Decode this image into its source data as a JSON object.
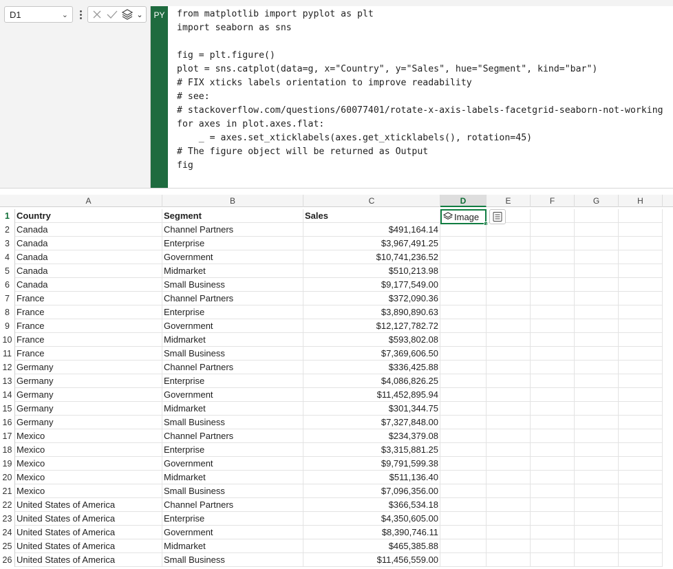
{
  "namebox": {
    "value": "D1"
  },
  "code_panel": {
    "badge": "PY",
    "lines": [
      "from matplotlib import pyplot as plt",
      "import seaborn as sns",
      "",
      "fig = plt.figure()",
      "plot = sns.catplot(data=g, x=\"Country\", y=\"Sales\", hue=\"Segment\", kind=\"bar\")",
      "# FIX xticks labels orientation to improve readability",
      "# see:",
      "# stackoverflow.com/questions/60077401/rotate-x-axis-labels-facetgrid-seaborn-not-working",
      "for axes in plot.axes.flat:",
      "    _ = axes.set_xticklabels(axes.get_xticklabels(), rotation=45)",
      "# The figure object will be returned as Output",
      "fig"
    ]
  },
  "columns": [
    "A",
    "B",
    "C",
    "D",
    "E",
    "F",
    "G",
    "H"
  ],
  "selected_column": "D",
  "header_row": {
    "country": "Country",
    "segment": "Segment",
    "sales": "Sales",
    "d1_value": "Image"
  },
  "rows": [
    [
      "Canada",
      "Channel Partners",
      "$491,164.14"
    ],
    [
      "Canada",
      "Enterprise",
      "$3,967,491.25"
    ],
    [
      "Canada",
      "Government",
      "$10,741,236.52"
    ],
    [
      "Canada",
      "Midmarket",
      "$510,213.98"
    ],
    [
      "Canada",
      "Small Business",
      "$9,177,549.00"
    ],
    [
      "France",
      "Channel Partners",
      "$372,090.36"
    ],
    [
      "France",
      "Enterprise",
      "$3,890,890.63"
    ],
    [
      "France",
      "Government",
      "$12,127,782.72"
    ],
    [
      "France",
      "Midmarket",
      "$593,802.08"
    ],
    [
      "France",
      "Small Business",
      "$7,369,606.50"
    ],
    [
      "Germany",
      "Channel Partners",
      "$336,425.88"
    ],
    [
      "Germany",
      "Enterprise",
      "$4,086,826.25"
    ],
    [
      "Germany",
      "Government",
      "$11,452,895.94"
    ],
    [
      "Germany",
      "Midmarket",
      "$301,344.75"
    ],
    [
      "Germany",
      "Small Business",
      "$7,327,848.00"
    ],
    [
      "Mexico",
      "Channel Partners",
      "$234,379.08"
    ],
    [
      "Mexico",
      "Enterprise",
      "$3,315,881.25"
    ],
    [
      "Mexico",
      "Government",
      "$9,791,599.38"
    ],
    [
      "Mexico",
      "Midmarket",
      "$511,136.40"
    ],
    [
      "Mexico",
      "Small Business",
      "$7,096,356.00"
    ],
    [
      "United States of America",
      "Channel Partners",
      "$366,534.18"
    ],
    [
      "United States of America",
      "Enterprise",
      "$4,350,605.00"
    ],
    [
      "United States of America",
      "Government",
      "$8,390,746.11"
    ],
    [
      "United States of America",
      "Midmarket",
      "$465,385.88"
    ],
    [
      "United States of America",
      "Small Business",
      "$11,456,559.00"
    ]
  ],
  "colors": {
    "accent": "#107c41",
    "py_badge": "#1e6b3f"
  }
}
